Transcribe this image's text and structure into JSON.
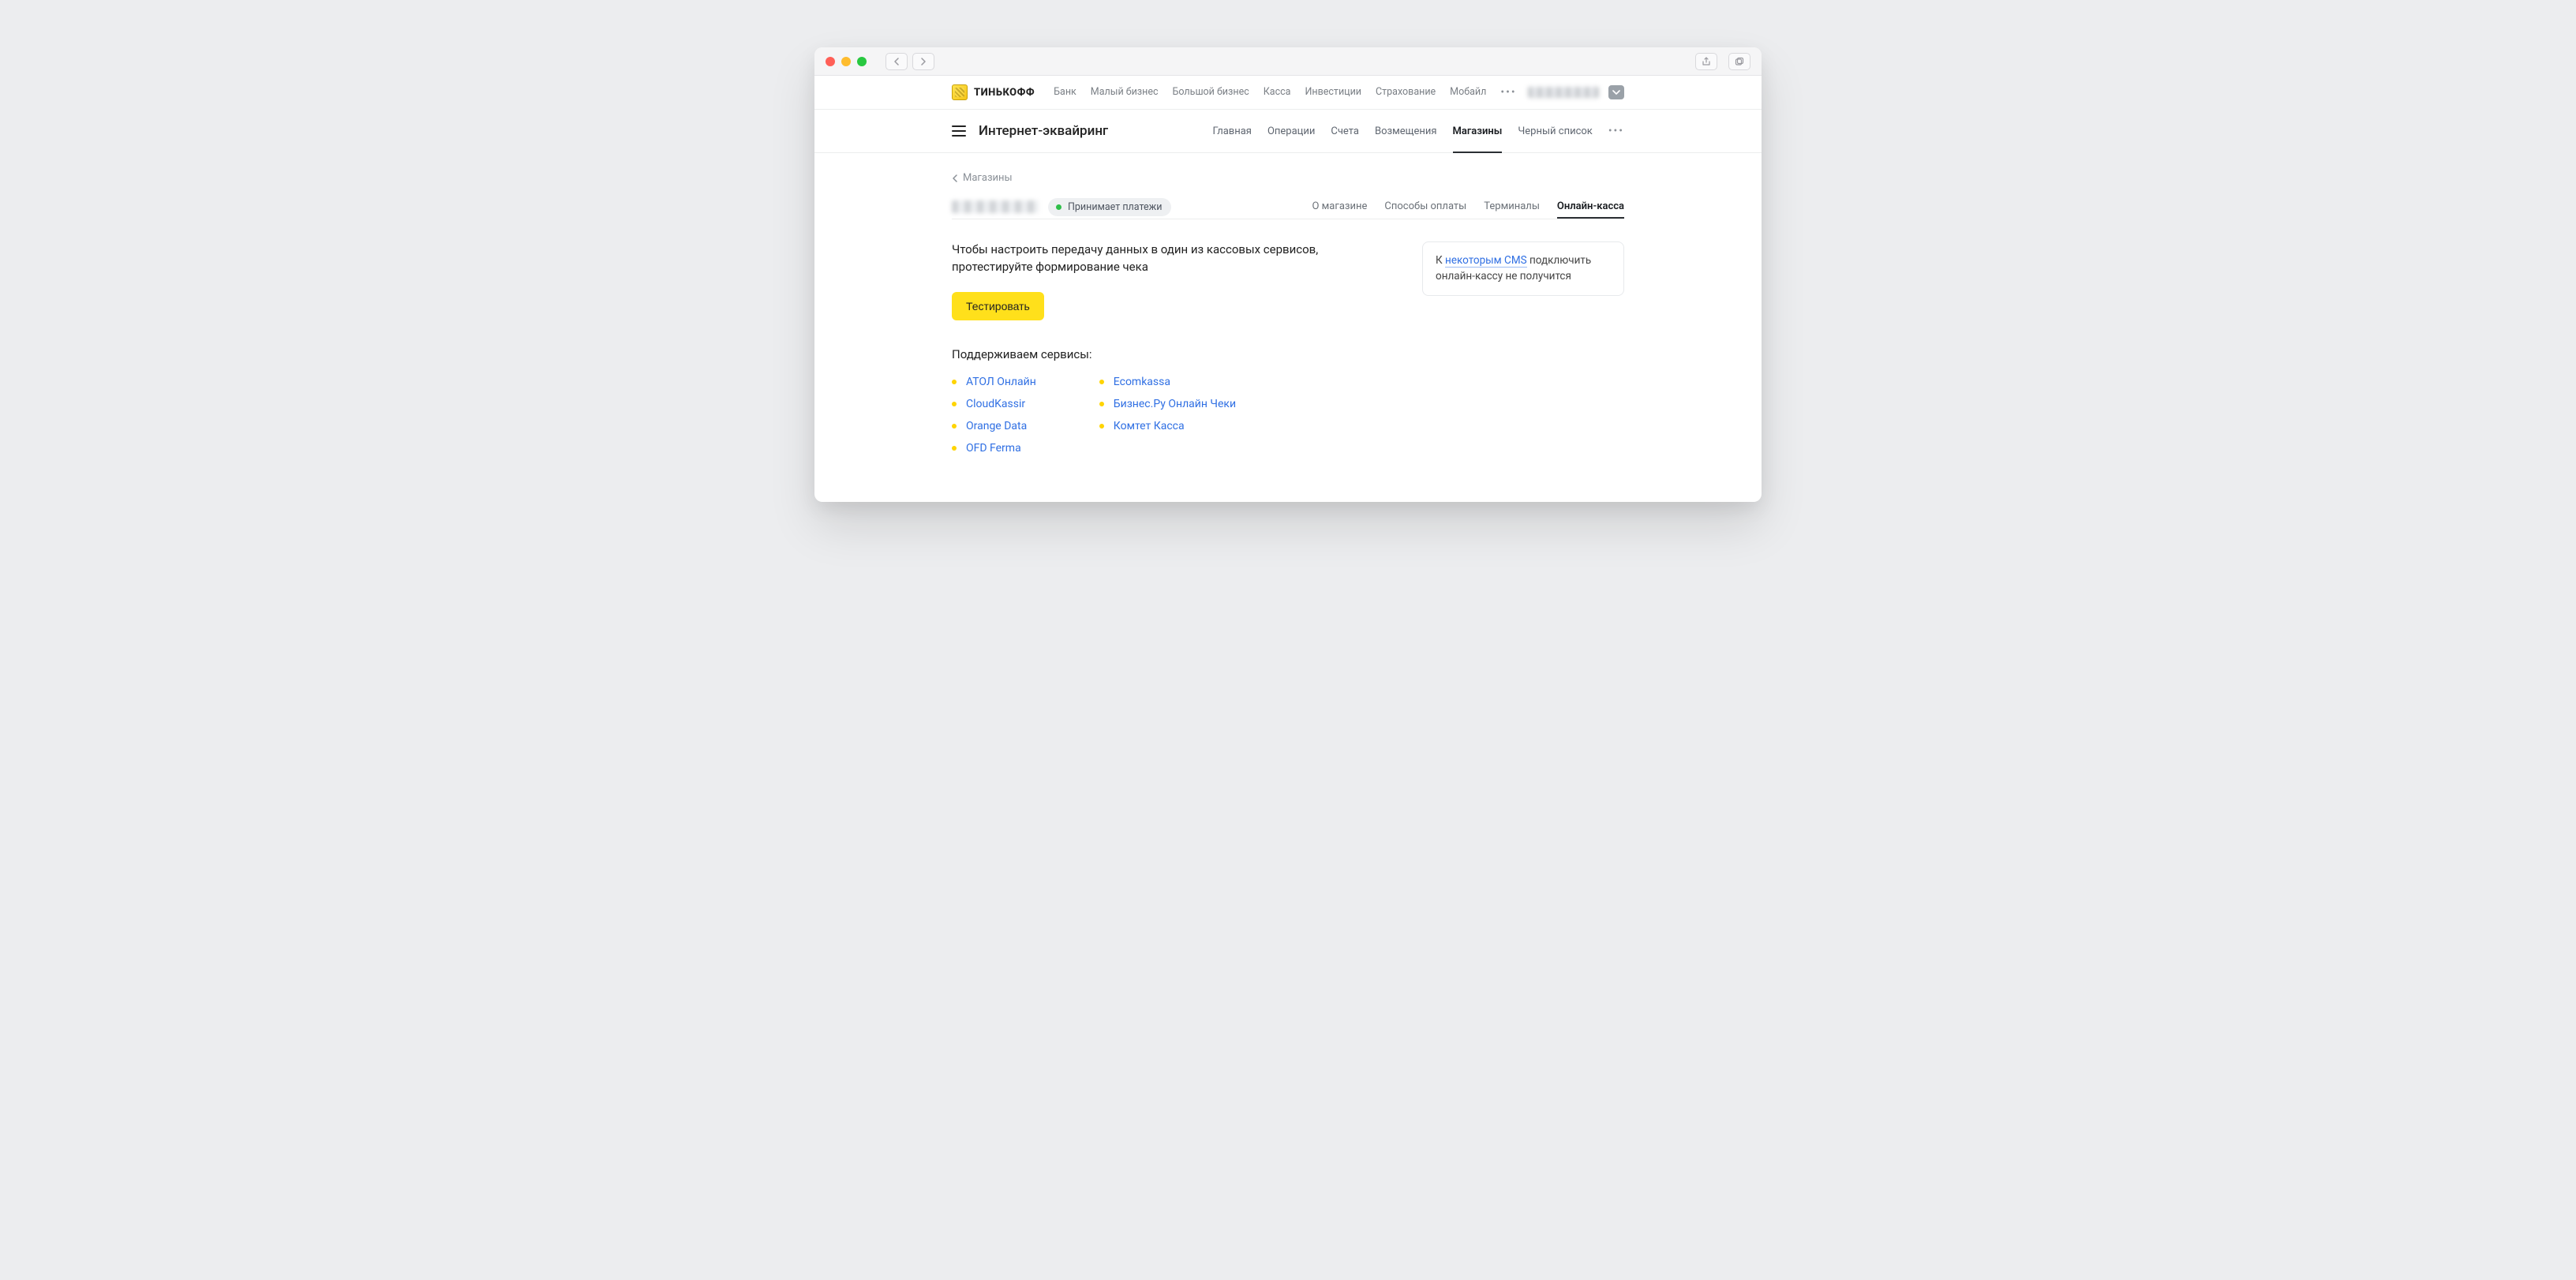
{
  "brand": "ТИНЬКОФФ",
  "topnav": {
    "items": [
      "Банк",
      "Малый бизнес",
      "Большой бизнес",
      "Касса",
      "Инвестиции",
      "Страхование",
      "Мобайл"
    ]
  },
  "subnav": {
    "title": "Интернет-эквайринг",
    "tabs": [
      "Главная",
      "Операции",
      "Счета",
      "Возмещения",
      "Магазины",
      "Черный список"
    ],
    "activeIndex": 4
  },
  "breadcrumb": {
    "label": "Магазины"
  },
  "status": {
    "label": "Принимает платежи"
  },
  "store_tabs": {
    "items": [
      "О магазине",
      "Способы оплаты",
      "Терминалы",
      "Онлайн-касса"
    ],
    "activeIndex": 3
  },
  "intro": "Чтобы настроить передачу данных в один из кассовых сервисов, протестируйте формирование чека",
  "test_button": "Тестировать",
  "services_header": "Поддерживаем сервисы:",
  "services_left": [
    "АТОЛ Онлайн",
    "CloudKassir",
    "Orange Data",
    "OFD Ferma"
  ],
  "services_right": [
    "Ecomkassa",
    "Бизнес.Ру Онлайн Чеки",
    "Комтет Касса"
  ],
  "infobox": {
    "pre": "К ",
    "link": "некоторым CMS",
    "post": " подключить онлайн-кассу не получится"
  }
}
